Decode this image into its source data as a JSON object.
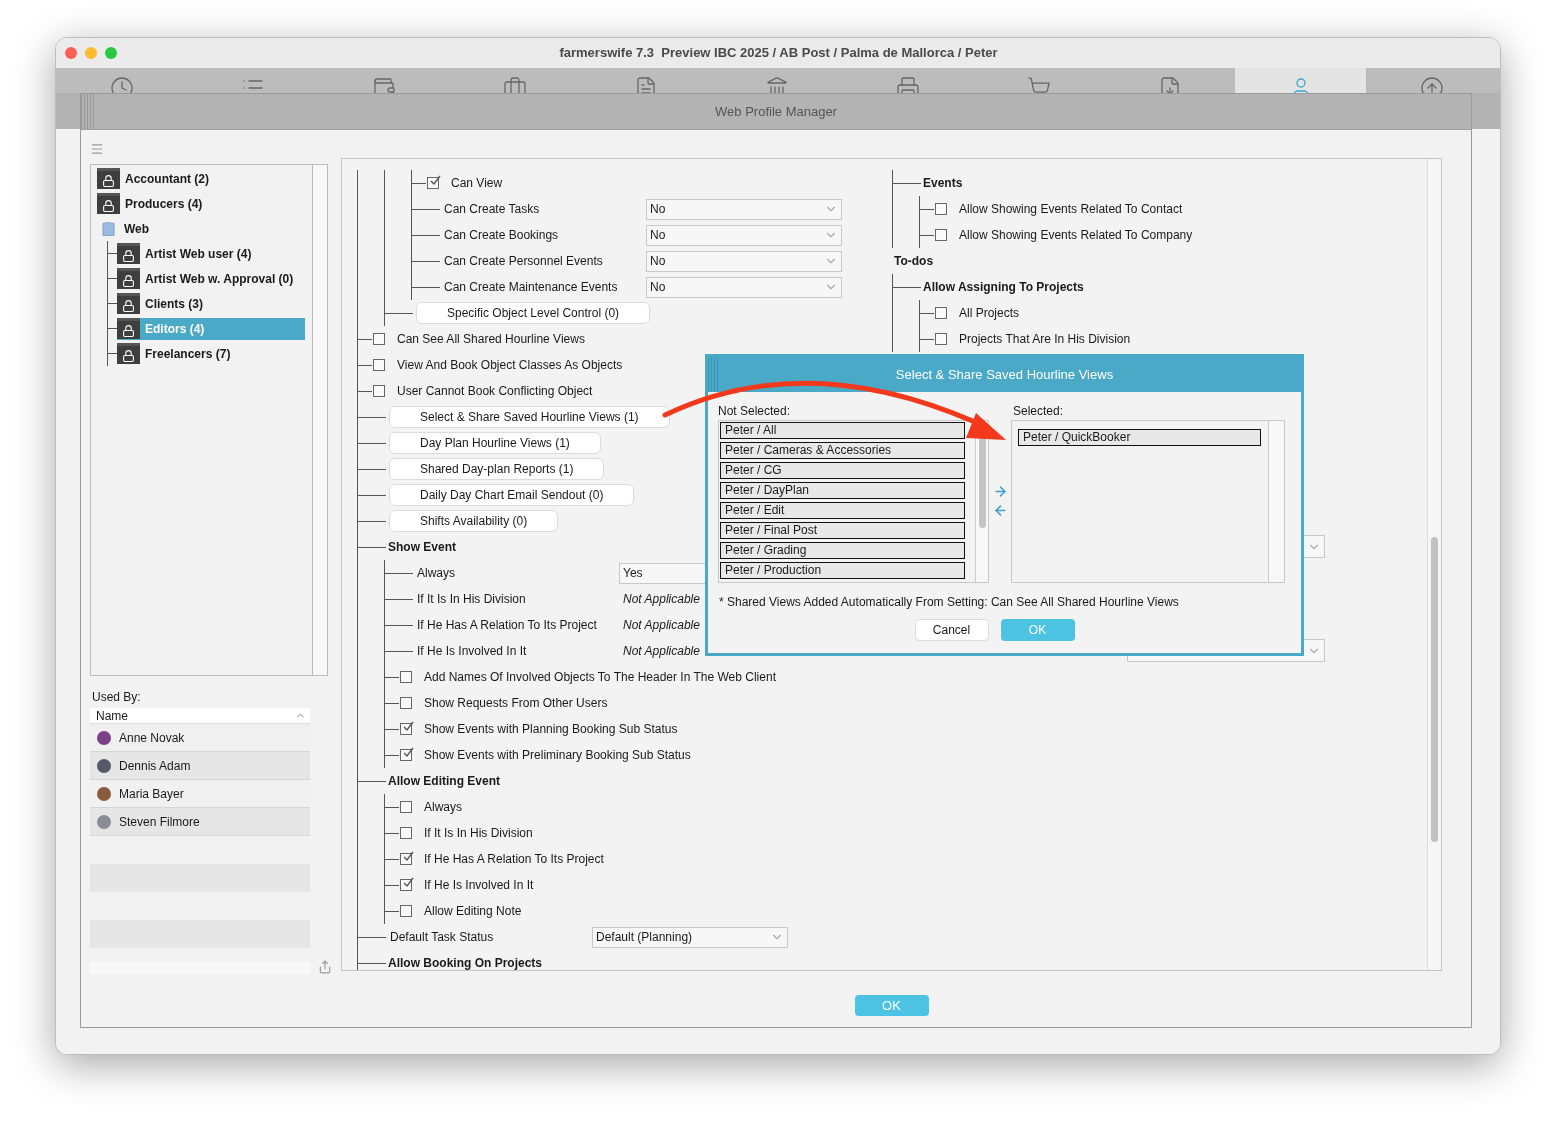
{
  "window": {
    "title": "farmerswife 7.3  Preview IBC 2025 / AB Post / Palma de Mallorca / Peter"
  },
  "toolbar": [
    {
      "selected": false
    },
    {
      "selected": false
    },
    {
      "selected": false
    },
    {
      "selected": false
    },
    {
      "selected": false
    },
    {
      "selected": false
    },
    {
      "selected": false
    },
    {
      "selected": false
    },
    {
      "selected": false
    },
    {
      "selected": true
    },
    {
      "selected": false
    }
  ],
  "sheet": {
    "title": "Web Profile Manager",
    "ok": "OK"
  },
  "profiles": [
    {
      "label": "Accountant (2)",
      "kind": "profile",
      "selected": false
    },
    {
      "label": "Producers (4)",
      "kind": "profile",
      "selected": false
    },
    {
      "label": "Web",
      "kind": "folder",
      "selected": false,
      "children": [
        {
          "label": "Artist Web user (4)",
          "kind": "profile",
          "selected": false
        },
        {
          "label": "Artist Web w. Approval (0)",
          "kind": "profile",
          "selected": false
        },
        {
          "label": "Clients (3)",
          "kind": "profile",
          "selected": false
        },
        {
          "label": "Editors (4)",
          "kind": "profile",
          "selected": true
        },
        {
          "label": "Freelancers (7)",
          "kind": "profile",
          "selected": false
        }
      ]
    }
  ],
  "used_by": {
    "label": "Used By:",
    "column": "Name",
    "rows": [
      "Anne Novak",
      "Dennis Adam",
      "Maria Bayer",
      "Steven Filmore"
    ]
  },
  "settings": [
    {
      "kind": "group",
      "children": [
        {
          "kind": "group",
          "children": [
            {
              "kind": "checkbox",
              "label": "Can View",
              "checked": true
            },
            {
              "kind": "select",
              "label": "Can Create Tasks",
              "value": "No"
            },
            {
              "kind": "select",
              "label": "Can Create Bookings",
              "value": "No"
            },
            {
              "kind": "select",
              "label": "Can Create Personnel Events",
              "value": "No"
            },
            {
              "kind": "select",
              "label": "Can Create Maintenance Events",
              "value": "No"
            }
          ]
        },
        {
          "kind": "button",
          "label": "Specific Object Level Control (0)"
        }
      ]
    },
    {
      "kind": "checkbox",
      "label": "Can See All Shared Hourline Views",
      "checked": false
    },
    {
      "kind": "checkbox",
      "label": "View And Book Object Classes As Objects",
      "checked": false
    },
    {
      "kind": "checkbox",
      "label": "User Cannot Book Conflicting Object",
      "checked": false
    },
    {
      "kind": "button",
      "label": "Select & Share Saved Hourline Views (1)"
    },
    {
      "kind": "button",
      "label": "Day Plan Hourline Views (1)"
    },
    {
      "kind": "button",
      "label": "Shared Day-plan Reports (1)"
    },
    {
      "kind": "button",
      "label": "Daily Day Chart Email Sendout (0)"
    },
    {
      "kind": "button",
      "label": "Shifts Availability (0)"
    },
    {
      "kind": "heading",
      "label": "Show Event",
      "children": [
        {
          "kind": "select",
          "label": "Always",
          "value": "Yes"
        },
        {
          "kind": "value",
          "label": "If It Is In His Division",
          "value": "Not Applicable"
        },
        {
          "kind": "value",
          "label": "If He Has A Relation To Its Project",
          "value": "Not Applicable"
        },
        {
          "kind": "value",
          "label": "If He Is Involved In It",
          "value": "Not Applicable"
        },
        {
          "kind": "checkbox",
          "label": "Add Names Of Involved Objects To The Header In The Web Client",
          "checked": false
        },
        {
          "kind": "checkbox",
          "label": "Show Requests From Other Users",
          "checked": false
        },
        {
          "kind": "checkbox",
          "label": "Show Events with Planning Booking Sub Status",
          "checked": true
        },
        {
          "kind": "checkbox",
          "label": "Show Events with Preliminary Booking Sub Status",
          "checked": true
        }
      ]
    },
    {
      "kind": "heading",
      "label": "Allow Editing Event",
      "children": [
        {
          "kind": "checkbox",
          "label": "Always",
          "checked": false
        },
        {
          "kind": "checkbox",
          "label": "If It Is In His Division",
          "checked": false
        },
        {
          "kind": "checkbox",
          "label": "If He Has A Relation To Its Project",
          "checked": true
        },
        {
          "kind": "checkbox",
          "label": "If He Is Involved In It",
          "checked": true
        },
        {
          "kind": "checkbox",
          "label": "Allow Editing Note",
          "checked": false
        }
      ]
    },
    {
      "kind": "select",
      "label": "Default Task Status",
      "value": "Default (Planning)"
    },
    {
      "kind": "heading",
      "label": "Allow Booking On Projects"
    }
  ],
  "settings_right": [
    {
      "kind": "group",
      "children": [
        {
          "kind": "heading",
          "label": "Events",
          "children": [
            {
              "kind": "checkbox",
              "label": "Allow Showing Events Related To Contact",
              "checked": false
            },
            {
              "kind": "checkbox",
              "label": "Allow Showing Events Related To Company",
              "checked": false
            }
          ]
        }
      ]
    },
    {
      "kind": "heading",
      "label": "To-dos",
      "children": [
        {
          "kind": "heading",
          "label": "Allow Assigning To Projects",
          "children": [
            {
              "kind": "checkbox",
              "label": "All Projects",
              "checked": false
            },
            {
              "kind": "checkbox",
              "label": "Projects That Are In His Division",
              "checked": false
            }
          ]
        }
      ]
    }
  ],
  "dialog": {
    "title": "Select & Share Saved Hourline Views",
    "not_selected_label": "Not Selected:",
    "not_selected": [
      "Peter / All",
      "Peter / Cameras & Accessories",
      "Peter / CG",
      "Peter / DayPlan",
      "Peter / Edit",
      "Peter / Final Post",
      "Peter / Grading",
      "Peter / Production"
    ],
    "selected_label": "Selected:",
    "selected": [
      "Peter / QuickBooker"
    ],
    "note": "* Shared Views Added Automatically From Setting: Can See All Shared Hourline Views",
    "cancel": "Cancel",
    "ok": "OK"
  }
}
